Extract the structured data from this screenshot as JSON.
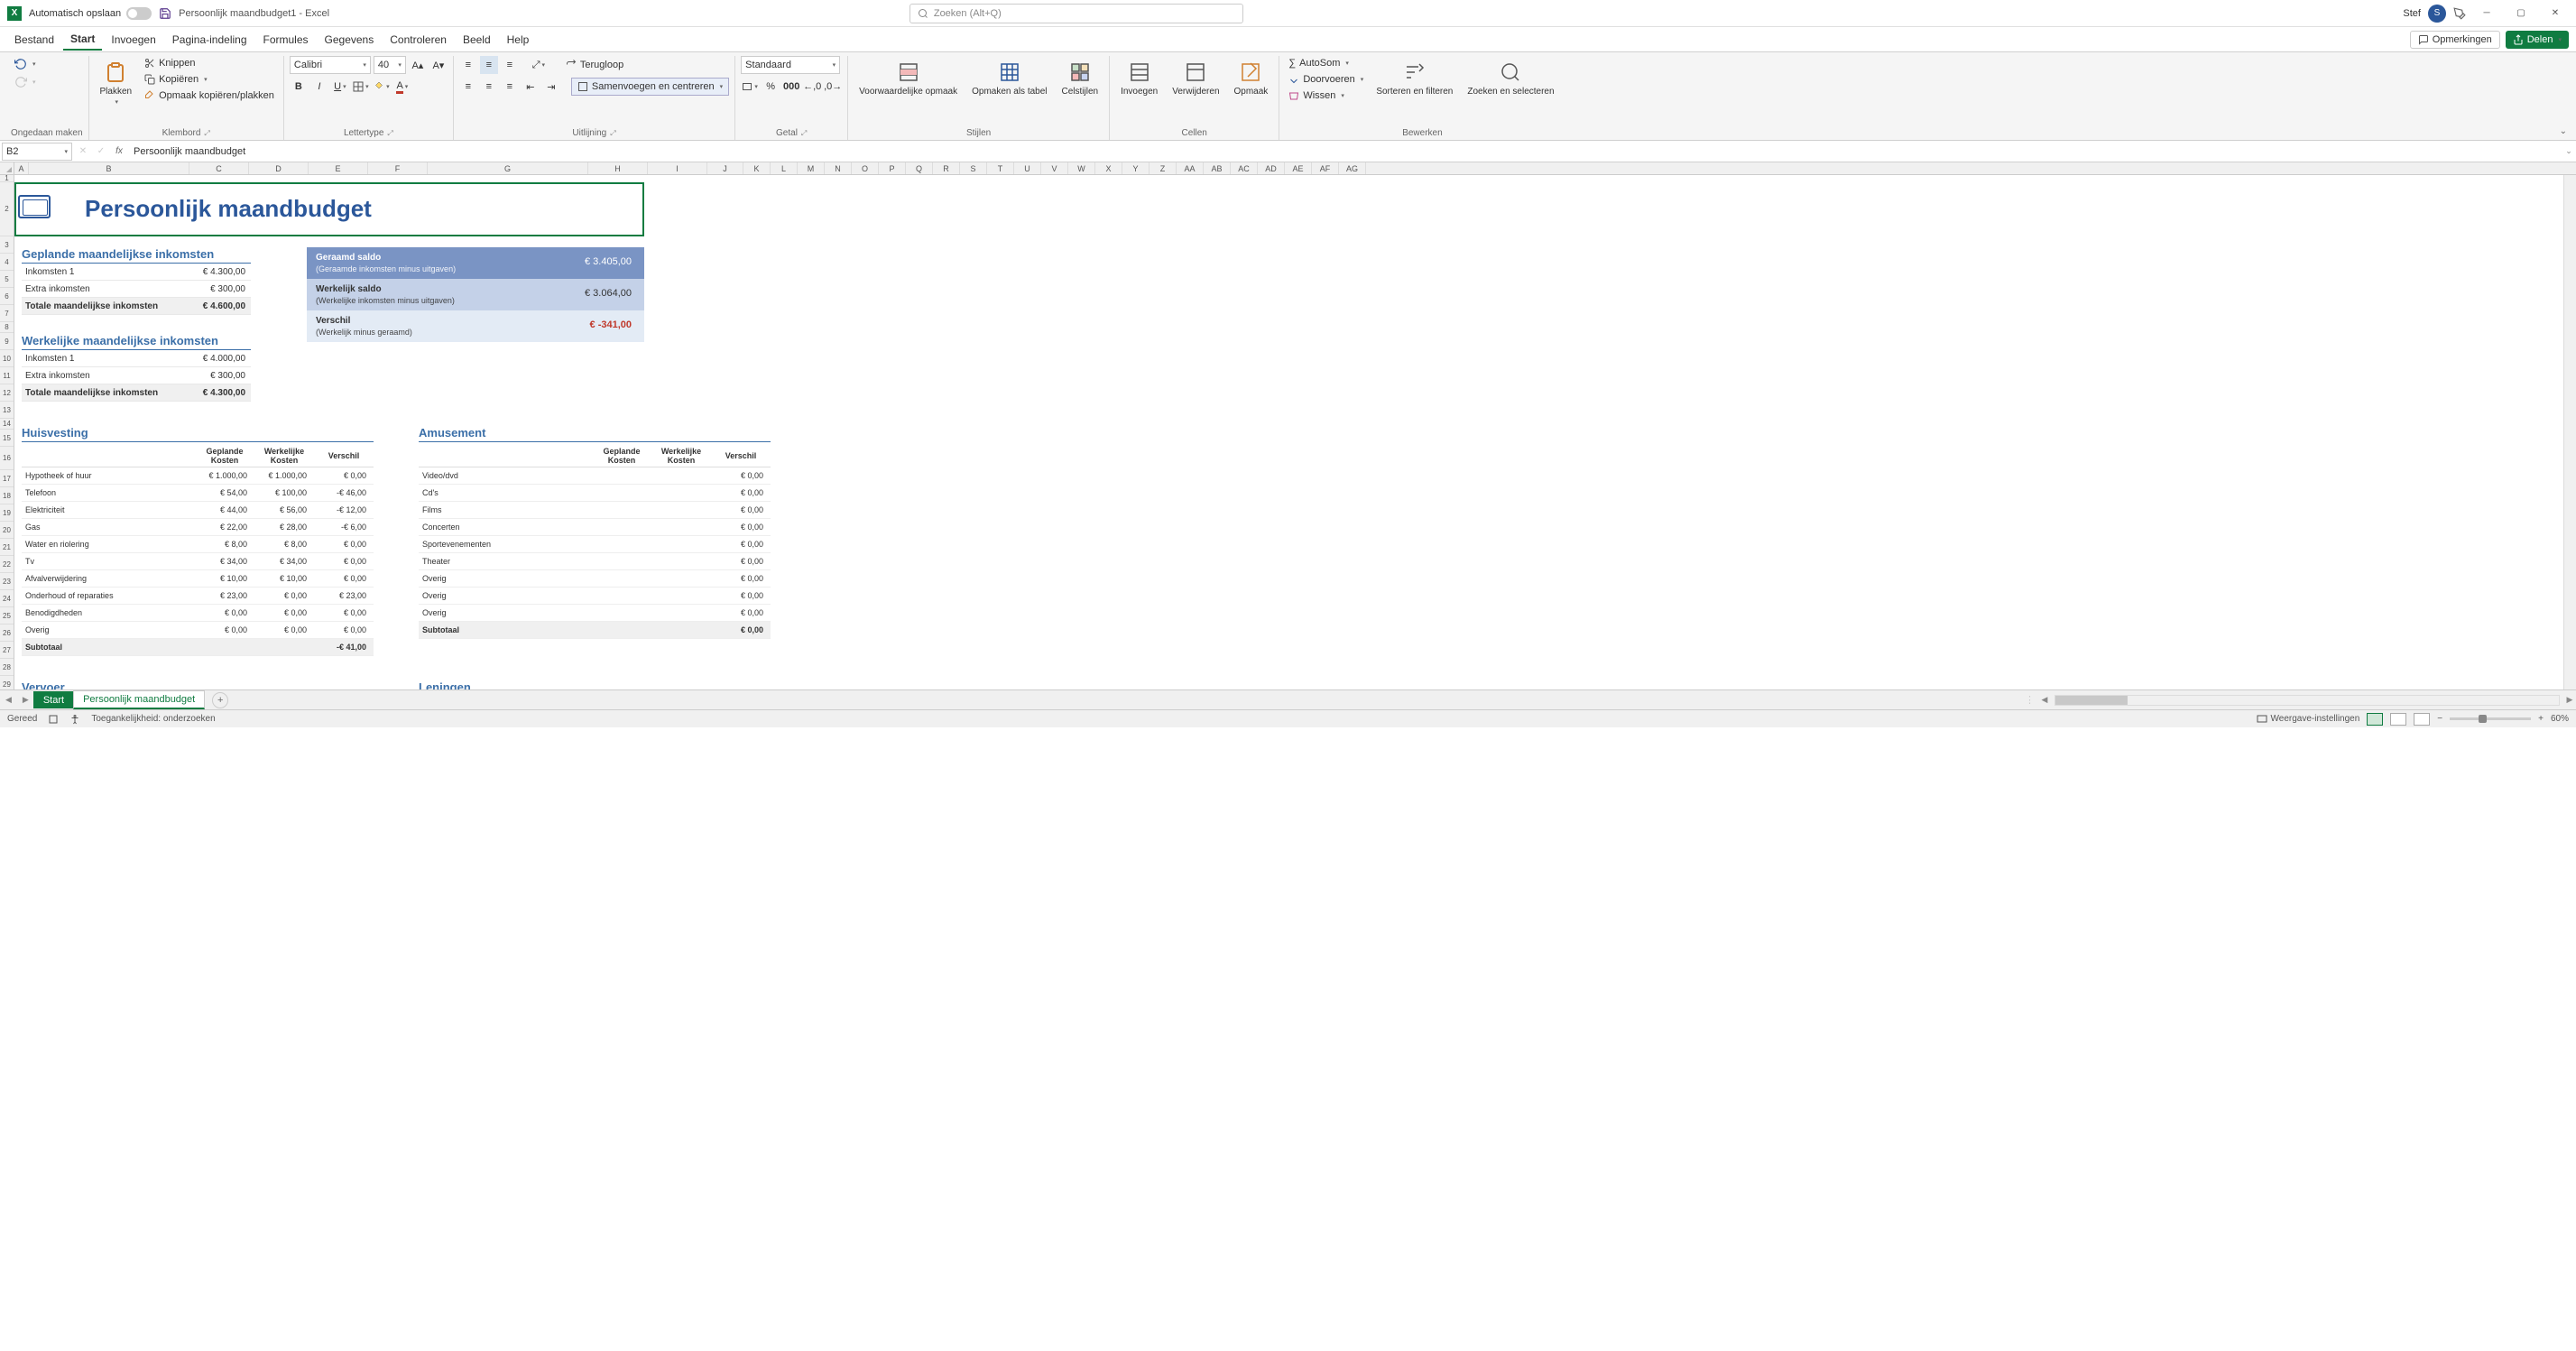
{
  "titlebar": {
    "autosave_label": "Automatisch opslaan",
    "doc_title": "Persoonlijk maandbudget1 - Excel",
    "search_placeholder": "Zoeken (Alt+Q)",
    "user_name": "Stef",
    "user_initial": "S"
  },
  "menu": {
    "items": [
      "Bestand",
      "Start",
      "Invoegen",
      "Pagina-indeling",
      "Formules",
      "Gegevens",
      "Controleren",
      "Beeld",
      "Help"
    ],
    "comments": "Opmerkingen",
    "share": "Delen"
  },
  "ribbon": {
    "undo_group": "Ongedaan maken",
    "paste": "Plakken",
    "cut": "Knippen",
    "copy": "Kopiëren",
    "format_painter": "Opmaak kopiëren/plakken",
    "clipboard": "Klembord",
    "font_name": "Calibri",
    "font_size": "40",
    "font_group": "Lettertype",
    "wrap": "Terugloop",
    "merge": "Samenvoegen en centreren",
    "align_group": "Uitlijning",
    "number_format": "Standaard",
    "number_group": "Getal",
    "cond_format": "Voorwaardelijke opmaak",
    "format_table": "Opmaken als tabel",
    "cell_styles": "Celstijlen",
    "styles_group": "Stijlen",
    "insert": "Invoegen",
    "delete": "Verwijderen",
    "format": "Opmaak",
    "cells_group": "Cellen",
    "autosum": "AutoSom",
    "fill": "Doorvoeren",
    "clear": "Wissen",
    "sort": "Sorteren en filteren",
    "find": "Zoeken en selecteren",
    "editing_group": "Bewerken"
  },
  "formula_bar": {
    "name_box": "B2",
    "formula": "Persoonlijk maandbudget"
  },
  "columns": [
    "A",
    "B",
    "C",
    "D",
    "E",
    "F",
    "G",
    "H",
    "I",
    "J",
    "K",
    "L",
    "M",
    "N",
    "O",
    "P",
    "Q",
    "R",
    "S",
    "T",
    "U",
    "V",
    "W",
    "X",
    "Y",
    "Z",
    "AA",
    "AB",
    "AC",
    "AD",
    "AE",
    "AF",
    "AG"
  ],
  "rows": [
    "1",
    "2",
    "3",
    "4",
    "5",
    "6",
    "7",
    "8",
    "9",
    "10",
    "11",
    "12",
    "13",
    "14",
    "15",
    "16",
    "17",
    "18",
    "19",
    "20",
    "21",
    "22",
    "23",
    "24",
    "25",
    "26",
    "27",
    "28",
    "29"
  ],
  "sheet": {
    "title": "Persoonlijk maandbudget",
    "planned_income_hdr": "Geplande maandelijkse inkomsten",
    "actual_income_hdr": "Werkelijke maandelijkse inkomsten",
    "income_rows": [
      {
        "label": "Inkomsten 1",
        "planned": "€ 4.300,00",
        "actual": "€ 4.000,00"
      },
      {
        "label": "Extra inkomsten",
        "planned": "€ 300,00",
        "actual": "€ 300,00"
      }
    ],
    "total_label": "Totale maandelijkse inkomsten",
    "planned_total": "€ 4.600,00",
    "actual_total": "€ 4.300,00",
    "balance": {
      "est_label": "Geraamd saldo",
      "est_sub": "(Geraamde inkomsten minus uitgaven)",
      "est_val": "€ 3.405,00",
      "act_label": "Werkelijk saldo",
      "act_sub": "(Werkelijke inkomsten minus uitgaven)",
      "act_val": "€ 3.064,00",
      "diff_label": "Verschil",
      "diff_sub": "(Werkelijk minus geraamd)",
      "diff_val": "€ -341,00"
    },
    "col_headers": {
      "planned": "Geplande Kosten",
      "actual": "Werkelijke Kosten",
      "diff": "Verschil"
    },
    "housing": {
      "title": "Huisvesting",
      "rows": [
        {
          "l": "Hypotheek of huur",
          "p": "€ 1.000,00",
          "a": "€ 1.000,00",
          "d": "€ 0,00"
        },
        {
          "l": "Telefoon",
          "p": "€ 54,00",
          "a": "€ 100,00",
          "d": "-€ 46,00"
        },
        {
          "l": "Elektriciteit",
          "p": "€ 44,00",
          "a": "€ 56,00",
          "d": "-€ 12,00"
        },
        {
          "l": "Gas",
          "p": "€ 22,00",
          "a": "€ 28,00",
          "d": "-€ 6,00"
        },
        {
          "l": "Water en riolering",
          "p": "€ 8,00",
          "a": "€ 8,00",
          "d": "€ 0,00"
        },
        {
          "l": "Tv",
          "p": "€ 34,00",
          "a": "€ 34,00",
          "d": "€ 0,00"
        },
        {
          "l": "Afvalverwijdering",
          "p": "€ 10,00",
          "a": "€ 10,00",
          "d": "€ 0,00"
        },
        {
          "l": "Onderhoud of reparaties",
          "p": "€ 23,00",
          "a": "€ 0,00",
          "d": "€ 23,00"
        },
        {
          "l": "Benodigdheden",
          "p": "€ 0,00",
          "a": "€ 0,00",
          "d": "€ 0,00"
        },
        {
          "l": "Overig",
          "p": "€ 0,00",
          "a": "€ 0,00",
          "d": "€ 0,00"
        }
      ],
      "subtotal_label": "Subtotaal",
      "subtotal_diff": "-€ 41,00"
    },
    "entertainment": {
      "title": "Amusement",
      "rows": [
        {
          "l": "Video/dvd",
          "d": "€ 0,00"
        },
        {
          "l": "Cd's",
          "d": "€ 0,00"
        },
        {
          "l": "Films",
          "d": "€ 0,00"
        },
        {
          "l": "Concerten",
          "d": "€ 0,00"
        },
        {
          "l": "Sportevenementen",
          "d": "€ 0,00"
        },
        {
          "l": "Theater",
          "d": "€ 0,00"
        },
        {
          "l": "Overig",
          "d": "€ 0,00"
        },
        {
          "l": "Overig",
          "d": "€ 0,00"
        },
        {
          "l": "Overig",
          "d": "€ 0,00"
        }
      ],
      "subtotal_label": "Subtotaal",
      "subtotal_diff": "€ 0,00"
    },
    "transport_title": "Vervoer",
    "loans_title": "Leningen"
  },
  "tabs": {
    "start": "Start",
    "budget": "Persoonlijk maandbudget"
  },
  "statusbar": {
    "ready": "Gereed",
    "accessibility": "Toegankelijkheid: onderzoeken",
    "display": "Weergave-instellingen",
    "zoom": "60%"
  }
}
